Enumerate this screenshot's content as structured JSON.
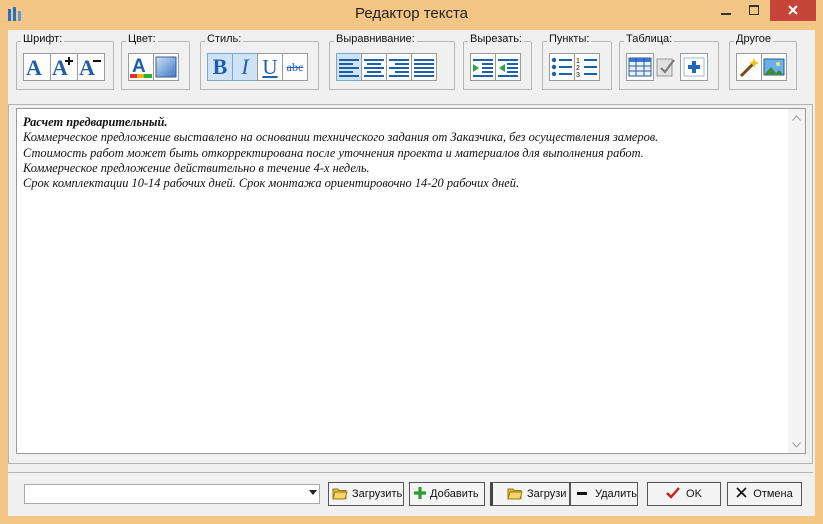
{
  "window": {
    "title": "Редактор текста"
  },
  "toolbar": {
    "groups": [
      {
        "label": "Шрифт:"
      },
      {
        "label": "Цвет:"
      },
      {
        "label": "Стиль:"
      },
      {
        "label": "Выравнивание:"
      },
      {
        "label": "Вырезать:"
      },
      {
        "label": "Пункты:"
      },
      {
        "label": "Таблица:"
      },
      {
        "label": "Другое"
      }
    ],
    "style_glyphs": {
      "bold": "B",
      "italic": "I",
      "underline": "U",
      "strike": "abc"
    },
    "font_glyphs": {
      "a1": "A",
      "a2": "A",
      "a3": "A"
    }
  },
  "editor": {
    "lines": [
      {
        "text": "Расчет предварительный.",
        "bold": true
      },
      {
        "text": "Коммерческое предложение выставлено на основании технического задания  от Заказчика, без осуществления замеров."
      },
      {
        "text": "Стоимость работ может быть откорректирована после уточнения проекта и материалов для выполнения работ."
      },
      {
        "text": "Коммерческое предложение действительно в течение 4-х недель."
      },
      {
        "text": "Срок комплектации 10-14 рабочих дней. Срок монтажа ориентировочно 14-20  рабочих дней."
      }
    ]
  },
  "footer": {
    "combo_value": "",
    "load_label": "Загрузить",
    "add_label": "Добавить",
    "load2_label": "Загрузи",
    "delete_label": "Удалить",
    "ok_label": "OK",
    "cancel_label": "Отмена"
  },
  "colors": {
    "title_bar": "#f3c686",
    "close_button": "#c7443a",
    "accent_blue": "#1f5fa8",
    "ok_check": "#cc1f1f"
  }
}
